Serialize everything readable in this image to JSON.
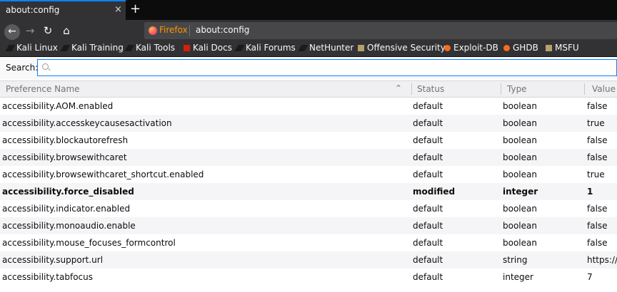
{
  "tab": {
    "title": "about:config",
    "close": "×",
    "newtab": "+"
  },
  "nav": {
    "back": "←",
    "forward": "→",
    "reload": "↻",
    "home": "⌂"
  },
  "urlbar": {
    "identity_label": "Firefox",
    "url": "about:config"
  },
  "bookmarks": [
    {
      "label": "Kali Linux",
      "icon": "kali-dragon-icon"
    },
    {
      "label": "Kali Training",
      "icon": "kali-dragon-icon"
    },
    {
      "label": "Kali Tools",
      "icon": "kali-dragon-icon"
    },
    {
      "label": "Kali Docs",
      "icon": "kali-docs-icon"
    },
    {
      "label": "Kali Forums",
      "icon": "kali-dragon-icon"
    },
    {
      "label": "NetHunter",
      "icon": "kali-dragon-icon"
    },
    {
      "label": "Offensive Security",
      "icon": "offsec-icon"
    },
    {
      "label": "Exploit-DB",
      "icon": "exploitdb-icon"
    },
    {
      "label": "GHDB",
      "icon": "exploitdb-icon"
    },
    {
      "label": "MSFU",
      "icon": "offsec-icon"
    }
  ],
  "search": {
    "label": "Search:",
    "value": "",
    "placeholder": ""
  },
  "columns": {
    "name": "Preference Name",
    "status": "Status",
    "type": "Type",
    "value": "Value"
  },
  "preferences": [
    {
      "name": "accessibility.AOM.enabled",
      "status": "default",
      "type": "boolean",
      "value": "false"
    },
    {
      "name": "accessibility.accesskeycausesactivation",
      "status": "default",
      "type": "boolean",
      "value": "true"
    },
    {
      "name": "accessibility.blockautorefresh",
      "status": "default",
      "type": "boolean",
      "value": "false"
    },
    {
      "name": "accessibility.browsewithcaret",
      "status": "default",
      "type": "boolean",
      "value": "false"
    },
    {
      "name": "accessibility.browsewithcaret_shortcut.enabled",
      "status": "default",
      "type": "boolean",
      "value": "true"
    },
    {
      "name": "accessibility.force_disabled",
      "status": "modified",
      "type": "integer",
      "value": "1"
    },
    {
      "name": "accessibility.indicator.enabled",
      "status": "default",
      "type": "boolean",
      "value": "false"
    },
    {
      "name": "accessibility.monoaudio.enable",
      "status": "default",
      "type": "boolean",
      "value": "false"
    },
    {
      "name": "accessibility.mouse_focuses_formcontrol",
      "status": "default",
      "type": "boolean",
      "value": "false"
    },
    {
      "name": "accessibility.support.url",
      "status": "default",
      "type": "string",
      "value": "https://s"
    },
    {
      "name": "accessibility.tabfocus",
      "status": "default",
      "type": "integer",
      "value": "7"
    }
  ],
  "colors": {
    "accent": "#0a84ff",
    "chrome_dark": "#0c0c0d",
    "toolbar": "#323234",
    "firefox_label": "#ff9400"
  }
}
